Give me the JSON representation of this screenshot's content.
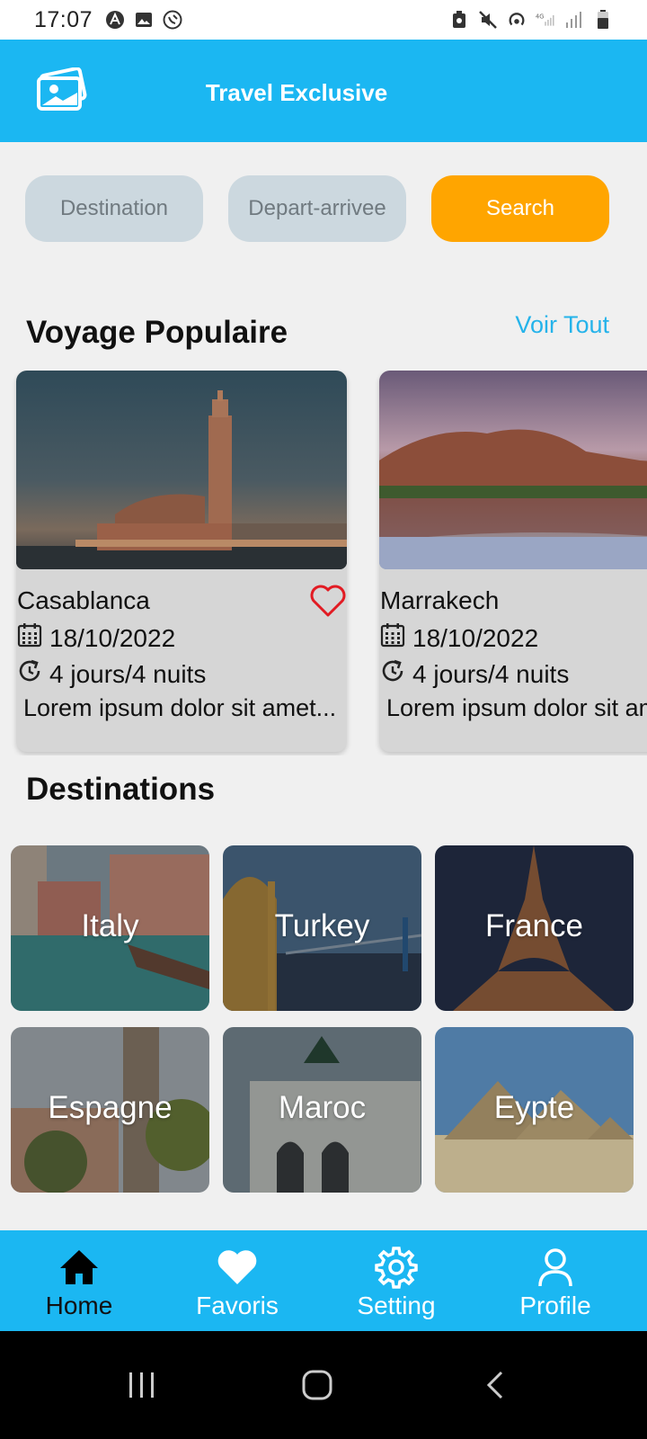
{
  "status_bar": {
    "time": "17:07"
  },
  "app_bar": {
    "title": "Travel Exclusive"
  },
  "search": {
    "destination_placeholder": "Destination",
    "dates_placeholder": "Depart-arrivee",
    "button_label": "Search"
  },
  "popular": {
    "title": "Voyage Populaire",
    "see_all": "Voir Tout",
    "trips": [
      {
        "city": "Casablanca",
        "date": "18/10/2022",
        "duration": "4 jours/4 nuits",
        "description": "Lorem ipsum dolor sit amet..."
      },
      {
        "city": "Marrakech",
        "date": "18/10/2022",
        "duration": "4 jours/4 nuits",
        "description": "Lorem ipsum dolor sit amet..."
      }
    ]
  },
  "destinations": {
    "title": "Destinations",
    "items": [
      {
        "name": "Italy"
      },
      {
        "name": "Turkey"
      },
      {
        "name": "France"
      },
      {
        "name": "Espagne"
      },
      {
        "name": "Maroc"
      },
      {
        "name": "Eypte"
      }
    ]
  },
  "bottom_nav": {
    "items": [
      {
        "label": "Home",
        "icon": "home-icon",
        "active": true
      },
      {
        "label": "Favoris",
        "icon": "heart-icon",
        "active": false
      },
      {
        "label": "Setting",
        "icon": "gear-icon",
        "active": false
      },
      {
        "label": "Profile",
        "icon": "profile-icon",
        "active": false
      }
    ]
  },
  "colors": {
    "primary": "#1bb7f2",
    "accent": "#ffa500",
    "input_bg": "#ccd8df",
    "card_bg": "#d6d6d6",
    "favorite": "#e21b23"
  }
}
